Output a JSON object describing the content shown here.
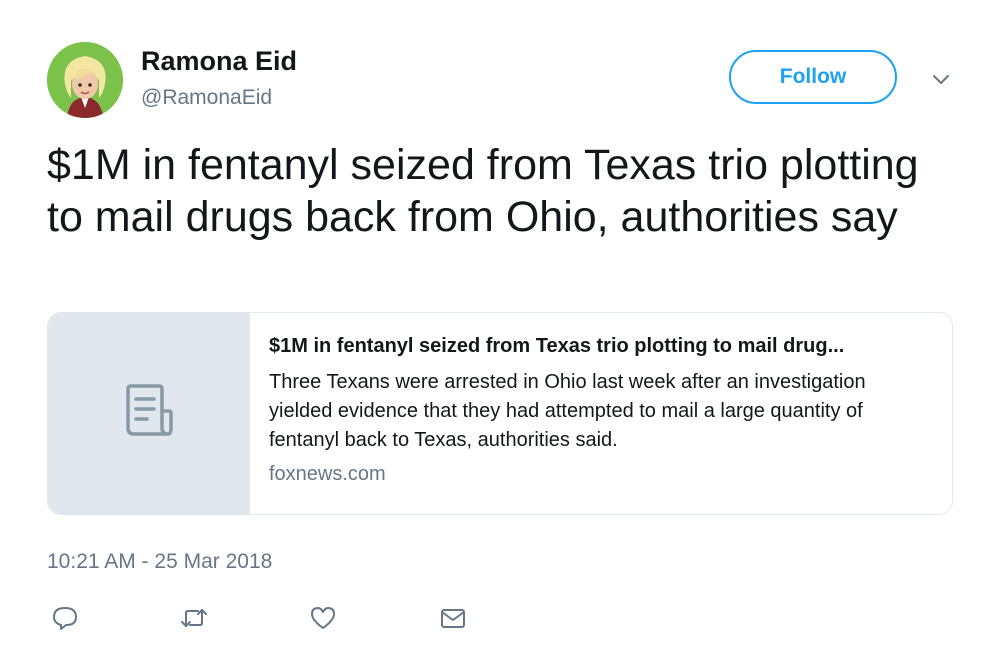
{
  "user": {
    "display_name": "Ramona Eid",
    "handle": "@RamonaEid"
  },
  "follow_label": "Follow",
  "tweet": {
    "text": "$1M in fentanyl seized from Texas trio plotting to mail drugs back from Ohio, authorities say",
    "timestamp": "10:21 AM - 25 Mar 2018"
  },
  "card": {
    "title": "$1M in fentanyl seized from Texas trio plotting to mail drug...",
    "description": "Three Texans were arrested in Ohio last week after an investigation yielded evidence that they had attempted to mail a large quantity of fentanyl back to Texas, authorities said.",
    "domain": "foxnews.com",
    "thumbnail_icon": "document-icon"
  },
  "actions": [
    "reply-icon",
    "retweet-icon",
    "like-icon",
    "direct-message-icon"
  ],
  "colors": {
    "accent": "#1da1f2",
    "secondary_text": "#657786",
    "card_border": "#e1e8ed"
  }
}
